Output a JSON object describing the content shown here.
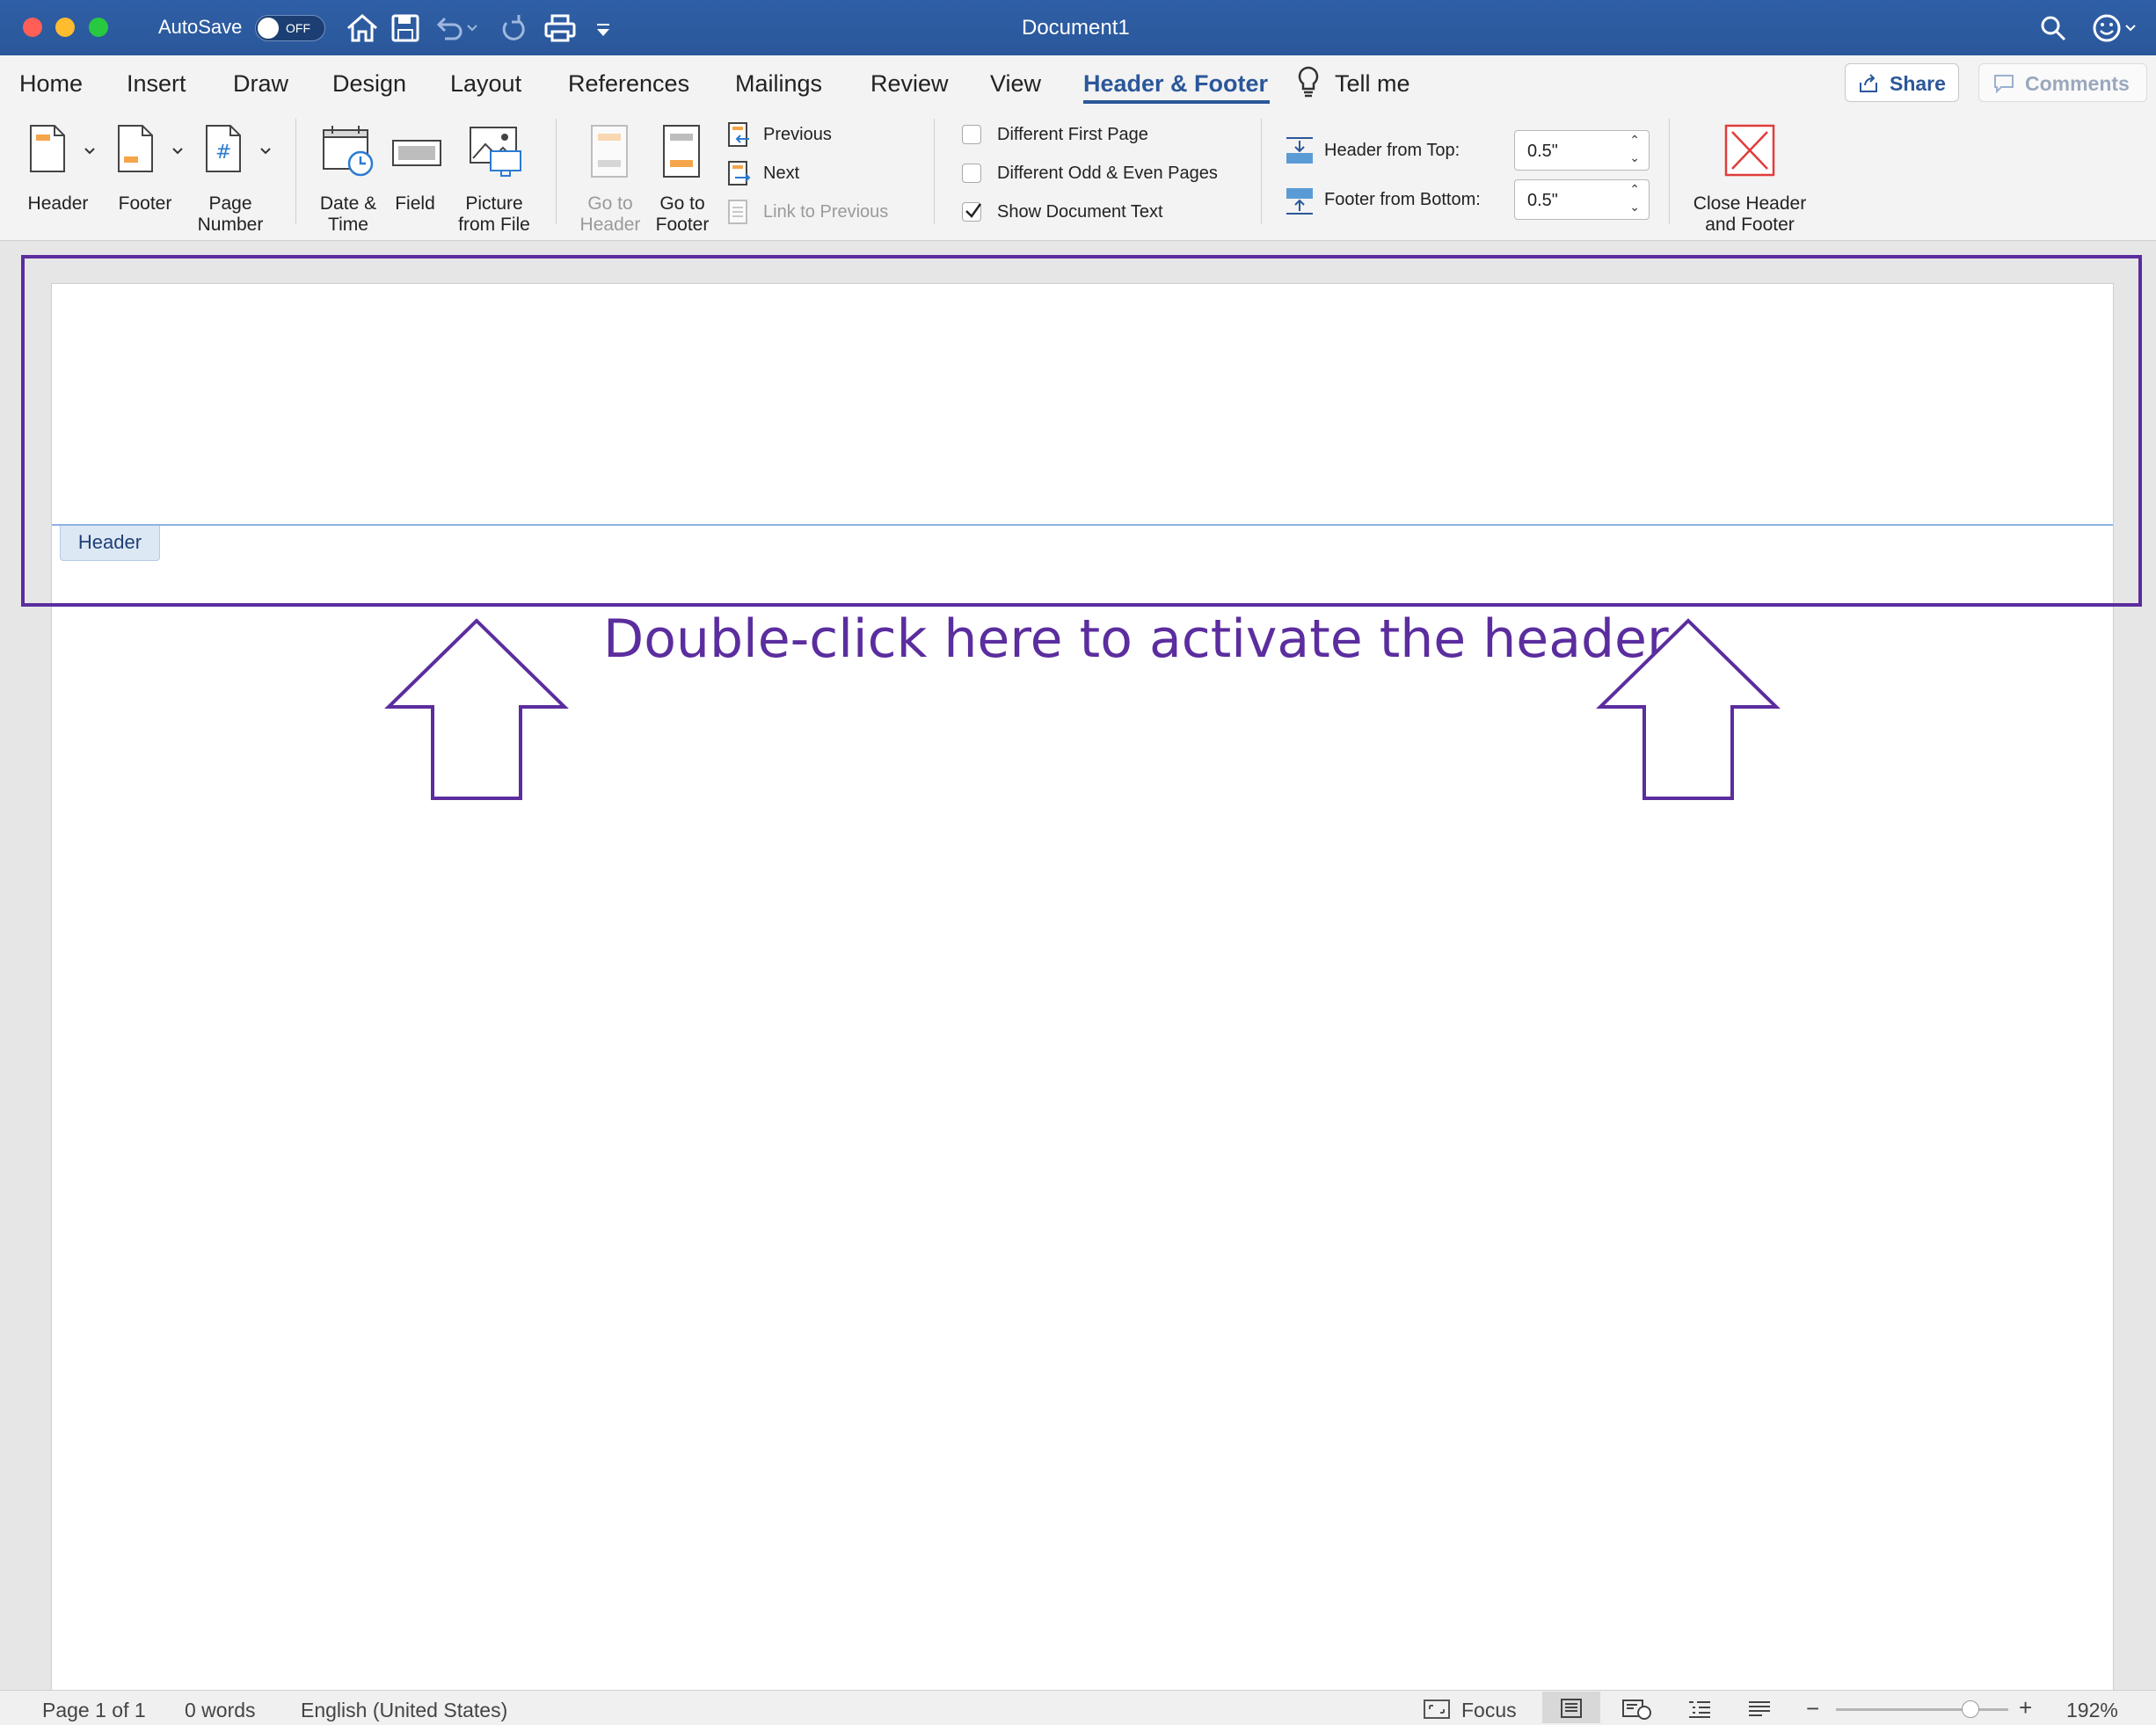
{
  "window": {
    "autosave_label": "AutoSave",
    "autosave_state": "OFF",
    "title": "Document1"
  },
  "tabs": [
    "Home",
    "Insert",
    "Draw",
    "Design",
    "Layout",
    "References",
    "Mailings",
    "Review",
    "View",
    "Header & Footer"
  ],
  "tell_me": "Tell me",
  "share_label": "Share",
  "comments_label": "Comments",
  "ribbon": {
    "header": "Header",
    "footer": "Footer",
    "page_number": [
      "Page",
      "Number"
    ],
    "date_time": [
      "Date &",
      "Time"
    ],
    "field": "Field",
    "picture": [
      "Picture",
      "from File"
    ],
    "go_header": [
      "Go to",
      "Header"
    ],
    "go_footer": [
      "Go to",
      "Footer"
    ],
    "previous": "Previous",
    "next": "Next",
    "link_previous": "Link to Previous",
    "diff_first": "Different First Page",
    "diff_odd_even": "Different Odd & Even Pages",
    "show_text": "Show Document Text",
    "header_from_top": "Header from Top:",
    "footer_from_bottom": "Footer from Bottom:",
    "header_top_value": "0.5\"",
    "footer_bottom_value": "0.5\"",
    "close": [
      "Close Header",
      "and Footer"
    ]
  },
  "checkboxes": {
    "diff_first": false,
    "diff_odd_even": false,
    "show_text": true
  },
  "document": {
    "header_tag": "Header",
    "annotation": "Double-click here to activate the header"
  },
  "status": {
    "page": "Page 1 of 1",
    "words": "0 words",
    "language": "English (United States)",
    "focus": "Focus",
    "zoom": "192%",
    "zoom_slider": 0.78
  },
  "colors": {
    "titlebar": "#2b579a",
    "accent": "#2b579a",
    "annotation": "#5b2d9e"
  }
}
